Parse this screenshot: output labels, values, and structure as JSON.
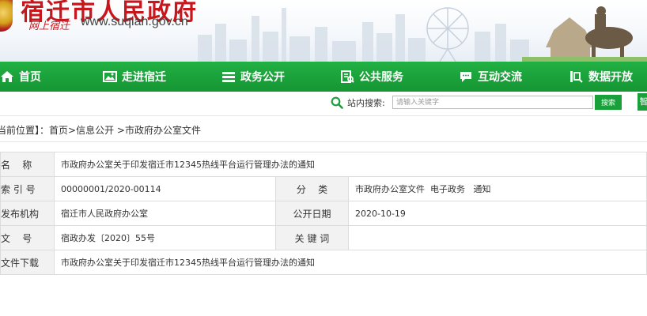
{
  "header": {
    "site_title": "宿迁市人民政府",
    "slogan": "网上宿迁",
    "url": "www.suqian.gov.cn"
  },
  "nav": {
    "items": [
      {
        "label": "首页",
        "icon": "home-icon"
      },
      {
        "label": "走进宿迁",
        "icon": "picture-icon"
      },
      {
        "label": "政务公开",
        "icon": "list-icon"
      },
      {
        "label": "公共服务",
        "icon": "service-icon"
      },
      {
        "label": "互动交流",
        "icon": "chat-icon"
      },
      {
        "label": "数据开放",
        "icon": "data-icon"
      }
    ]
  },
  "search": {
    "label": "站内搜索:",
    "placeholder": "请输入关键字",
    "button": "搜索",
    "side_button": "智"
  },
  "breadcrumb": {
    "prefix": "当前位置】：",
    "path": "首页>信息公开 >市政府办公室文件"
  },
  "info": {
    "name_label": "名    称",
    "name_value": "市政府办公室关于印发宿迁市12345热线平台运行管理办法的通知",
    "index_label": "索 引 号",
    "index_value": "00000001/2020-00114",
    "category_label": "分    类",
    "category_value": "市政府办公室文件  电子政务   通知",
    "publisher_label": "发布机构",
    "publisher_value": "宿迁市人民政府办公室",
    "date_label": "公开日期",
    "date_value": "2020-10-19",
    "docno_label": "文    号",
    "docno_value": "宿政办发〔2020〕55号",
    "keywords_label": "关 键 词",
    "keywords_value": "",
    "download_label": "文件下载",
    "download_value": "市政府办公室关于印发宿迁市12345热线平台运行管理办法的通知"
  },
  "colors": {
    "nav_green": "#1aa03b",
    "title_red": "#c8161d"
  }
}
